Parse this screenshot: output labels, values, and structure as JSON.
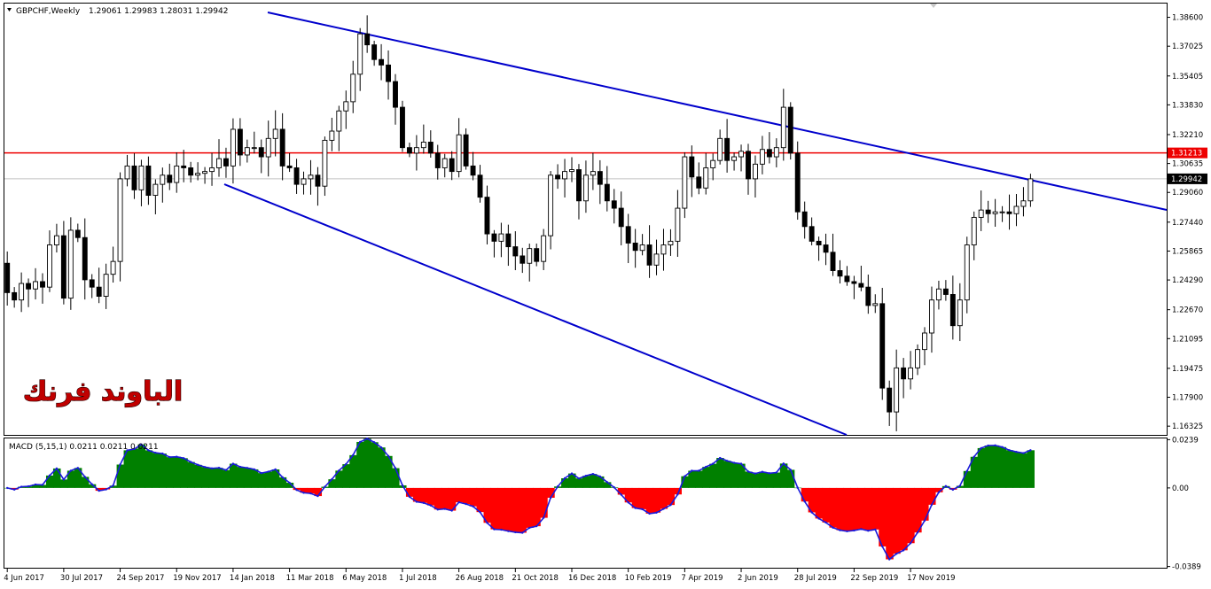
{
  "header": {
    "symbol_label": "GBPCHF,Weekly",
    "ohlc_text": "1.29061 1.29983 1.28031 1.29942"
  },
  "indicator": {
    "label": "MACD (5,15,1) 0.0211 0.0211 0.0211"
  },
  "watermark": {
    "text": "الباوند فرنك"
  },
  "colors": {
    "bull": "#008000",
    "bear": "#000000",
    "trendline": "#0000cc",
    "resistance": "#ee0000",
    "macd_positive": "#008000",
    "macd_negative": "#ff0000",
    "macd_line": "#1a1adb"
  },
  "chart_data": [
    {
      "type": "candlestick",
      "title": "GBPCHF,Weekly",
      "timeframe": "Weekly",
      "price_axis": {
        "ylim": [
          1.1585,
          1.3935
        ],
        "tick_labels": [
          "1.38600",
          "1.37025",
          "1.35405",
          "1.33830",
          "1.32210",
          "1.30635",
          "1.29060",
          "1.27440",
          "1.25865",
          "1.24290",
          "1.22670",
          "1.21095",
          "1.19475",
          "1.17900",
          "1.16325"
        ],
        "current_price_label": "1.29942",
        "resistance_label": "1.31213"
      },
      "time_axis": {
        "first_bar_date": "2017-06-04",
        "bar_interval_days": 7,
        "tick_labels": [
          "4 Jun 2017",
          "30 Jul 2017",
          "24 Sep 2017",
          "19 Nov 2017",
          "14 Jan 2018",
          "11 Mar 2018",
          "6 May 2018",
          "1 Jul 2018",
          "26 Aug 2018",
          "21 Oct 2018",
          "16 Dec 2018",
          "10 Feb 2019",
          "7 Apr 2019",
          "2 Jun 2019",
          "28 Jul 2019",
          "22 Sep 2019",
          "17 Nov 2019"
        ],
        "tick_every_bars": 8
      },
      "closes": [
        1.236,
        1.232,
        1.241,
        1.238,
        1.242,
        1.239,
        1.262,
        1.267,
        1.233,
        1.27,
        1.266,
        1.243,
        1.239,
        1.234,
        1.246,
        1.253,
        1.298,
        1.305,
        1.292,
        1.305,
        1.289,
        1.295,
        1.3,
        1.296,
        1.305,
        1.304,
        1.3,
        1.301,
        1.302,
        1.304,
        1.309,
        1.305,
        1.325,
        1.311,
        1.315,
        1.315,
        1.31,
        1.32,
        1.325,
        1.305,
        1.304,
        1.295,
        1.298,
        1.3,
        1.294,
        1.319,
        1.324,
        1.335,
        1.34,
        1.355,
        1.377,
        1.371,
        1.363,
        1.36,
        1.351,
        1.337,
        1.315,
        1.312,
        1.315,
        1.318,
        1.312,
        1.304,
        1.309,
        1.302,
        1.322,
        1.305,
        1.3,
        1.288,
        1.268,
        1.264,
        1.268,
        1.261,
        1.256,
        1.252,
        1.26,
        1.253,
        1.267,
        1.3,
        1.298,
        1.302,
        1.303,
        1.286,
        1.3,
        1.302,
        1.295,
        1.286,
        1.282,
        1.272,
        1.263,
        1.259,
        1.262,
        1.251,
        1.257,
        1.262,
        1.264,
        1.282,
        1.31,
        1.299,
        1.293,
        1.304,
        1.308,
        1.32,
        1.308,
        1.31,
        1.313,
        1.298,
        1.306,
        1.314,
        1.31,
        1.315,
        1.337,
        1.312,
        1.28,
        1.272,
        1.264,
        1.262,
        1.258,
        1.248,
        1.245,
        1.242,
        1.241,
        1.239,
        1.229,
        1.23,
        1.184,
        1.171,
        1.195,
        1.189,
        1.195,
        1.205,
        1.214,
        1.232,
        1.238,
        1.235,
        1.218,
        1.232,
        1.262,
        1.277,
        1.281,
        1.279,
        1.28,
        1.28,
        1.279,
        1.283,
        1.286,
        1.298
      ],
      "macd": {
        "name": "MACD (5,15,1)",
        "value": 0.0211,
        "zero_label": "0.00",
        "ylim": [
          -0.0395,
          0.0245
        ],
        "tick_labels": [
          "0.0239",
          "0.00",
          "-0.0389"
        ]
      }
    }
  ]
}
